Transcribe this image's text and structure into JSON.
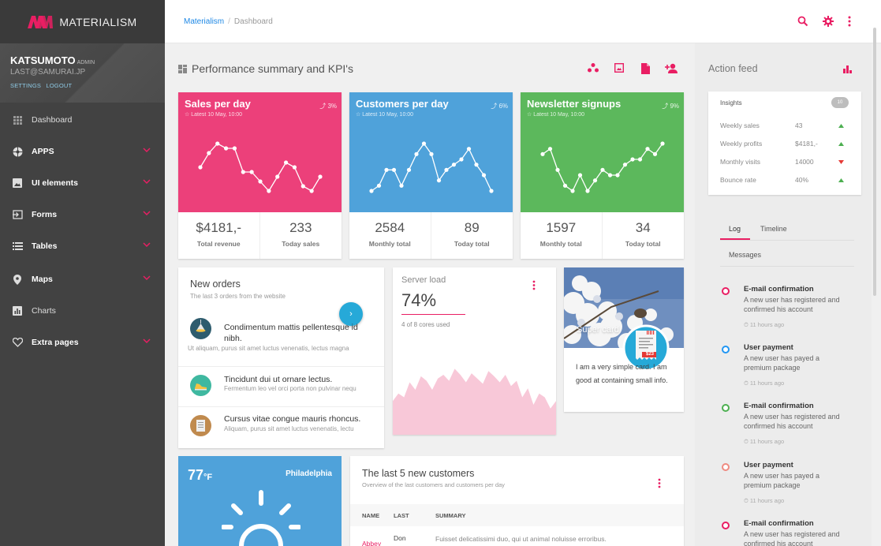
{
  "brand": {
    "name": "MATERIALISM",
    "color": "#e91e63"
  },
  "user": {
    "name": "KATSUMOTO",
    "role": "ADMIN",
    "email": "LAST@SAMURAI.JP",
    "settings": "SETTINGS",
    "logout": "LOGOUT"
  },
  "nav": [
    {
      "label": "Dashboard",
      "icon": "grid-icon",
      "chevron": false
    },
    {
      "label": "APPS",
      "icon": "apps-icon",
      "chevron": true
    },
    {
      "label": "UI elements",
      "icon": "image-icon",
      "chevron": true
    },
    {
      "label": "Forms",
      "icon": "login-icon",
      "chevron": true
    },
    {
      "label": "Tables",
      "icon": "list-icon",
      "chevron": true
    },
    {
      "label": "Maps",
      "icon": "pin-icon",
      "chevron": true
    },
    {
      "label": "Charts",
      "icon": "chart-icon",
      "chevron": false
    },
    {
      "label": "Extra pages",
      "icon": "heart-icon",
      "chevron": true
    }
  ],
  "breadcrumb": {
    "root": "Materialism",
    "current": "Dashboard"
  },
  "main": {
    "title": "Performance summary and KPI's"
  },
  "kpis": [
    {
      "title": "Sales per day",
      "subtitle": "☆ Latest 10 May, 10:00",
      "percent": "3%",
      "color": "#ec407a",
      "left_value": "$4181,-",
      "left_label": "Total revenue",
      "right_value": "233",
      "right_label": "Today sales",
      "points": [
        6,
        9,
        11,
        10,
        10,
        5,
        5,
        3,
        1,
        4,
        7,
        6,
        2,
        1,
        4
      ]
    },
    {
      "title": "Customers per day",
      "subtitle": "☆ Latest 10 May, 10:00",
      "percent": "6%",
      "color": "#4fa2da",
      "left_value": "2584",
      "left_label": "Monthly total",
      "right_value": "89",
      "right_label": "Today total",
      "points": [
        1,
        2,
        5,
        5,
        2,
        5,
        8,
        10,
        8,
        3,
        5,
        6,
        7,
        9,
        6,
        4,
        1
      ]
    },
    {
      "title": "Newsletter signups",
      "subtitle": "☆ Latest 10 May, 10:00",
      "percent": "9%",
      "color": "#5cb85c",
      "left_value": "1597",
      "left_label": "Monthly total",
      "right_value": "34",
      "right_label": "Today total",
      "points": [
        8,
        9,
        5,
        2,
        1,
        4,
        1,
        3,
        5,
        4,
        4,
        6,
        7,
        7,
        9,
        8,
        10
      ]
    }
  ],
  "orders": {
    "title": "New orders",
    "subtitle": "The last 3 orders from the website",
    "items": [
      {
        "title": "Condimentum mattis pellentesque id nibh.",
        "desc": "Ut aliquam, purus sit amet luctus venenatis, lectus magna",
        "icon": "lamp-icon",
        "color": "#2e5c6e"
      },
      {
        "title": "Tincidunt dui ut ornare lectus.",
        "desc": "Fermentum leo vel orci porta non pulvinar nequ",
        "icon": "shoe-icon",
        "color": "#3fb8a0"
      },
      {
        "title": "Cursus vitae congue mauris rhoncus.",
        "desc": "Aliquam, purus sit amet luctus venenatis, lectu",
        "icon": "notebook-icon",
        "color": "#c08a4e"
      }
    ]
  },
  "server": {
    "title": "Server load",
    "value": "74%",
    "sub": "4 of 8 cores used",
    "load": [
      0.45,
      0.55,
      0.5,
      0.7,
      0.6,
      0.78,
      0.72,
      0.6,
      0.75,
      0.8,
      0.72,
      0.88,
      0.8,
      0.7,
      0.82,
      0.75,
      0.68,
      0.85,
      0.78,
      0.7,
      0.8,
      0.65,
      0.72,
      0.5,
      0.62,
      0.4,
      0.55,
      0.5,
      0.35,
      0.45
    ]
  },
  "supercard": {
    "title": "Super card",
    "text": "I am a very simple card. I am good at containing small info.",
    "receipt": "$23"
  },
  "weather": {
    "temp": "77",
    "unit": "°F",
    "city": "Philadelphia"
  },
  "customers": {
    "title": "The last 5 new customers",
    "subtitle": "Overview of the last customers and customers per day",
    "columns": [
      "NAME",
      "LAST",
      "SUMMARY"
    ],
    "row": {
      "name": "Abbey",
      "last": "Don",
      "summary": "Fuisset delicatissimi duo, qui ut animal noluisse erroribus."
    }
  },
  "action_feed": {
    "title": "Action feed",
    "insights": {
      "title": "Insights",
      "badge": "10",
      "rows": [
        {
          "label": "Weekly sales",
          "value": "43",
          "trend": "up"
        },
        {
          "label": "Weekly profits",
          "value": "$4181,-",
          "trend": "up"
        },
        {
          "label": "Monthly visits",
          "value": "14000",
          "trend": "down"
        },
        {
          "label": "Bounce rate",
          "value": "40%",
          "trend": "up"
        }
      ]
    },
    "tabs": [
      "Log",
      "Timeline",
      "Messages"
    ],
    "timeline": [
      {
        "title": "E-mail confirmation",
        "desc": "A new user has registered and confirmed his account",
        "time": "⏱ 11 hours ago",
        "color": "#e91e63"
      },
      {
        "title": "User payment",
        "desc": "A new user has payed a premium package",
        "time": "⏱ 11 hours ago",
        "color": "#2196f3"
      },
      {
        "title": "E-mail confirmation",
        "desc": "A new user has registered and confirmed his account",
        "time": "⏱ 11 hours ago",
        "color": "#4caf50"
      },
      {
        "title": "User payment",
        "desc": "A new user has payed a premium package",
        "time": "⏱ 11 hours ago",
        "color": "#ef8a80"
      },
      {
        "title": "E-mail confirmation",
        "desc": "A new user has registered and confirmed his account",
        "time": "",
        "color": "#e91e63"
      }
    ]
  }
}
